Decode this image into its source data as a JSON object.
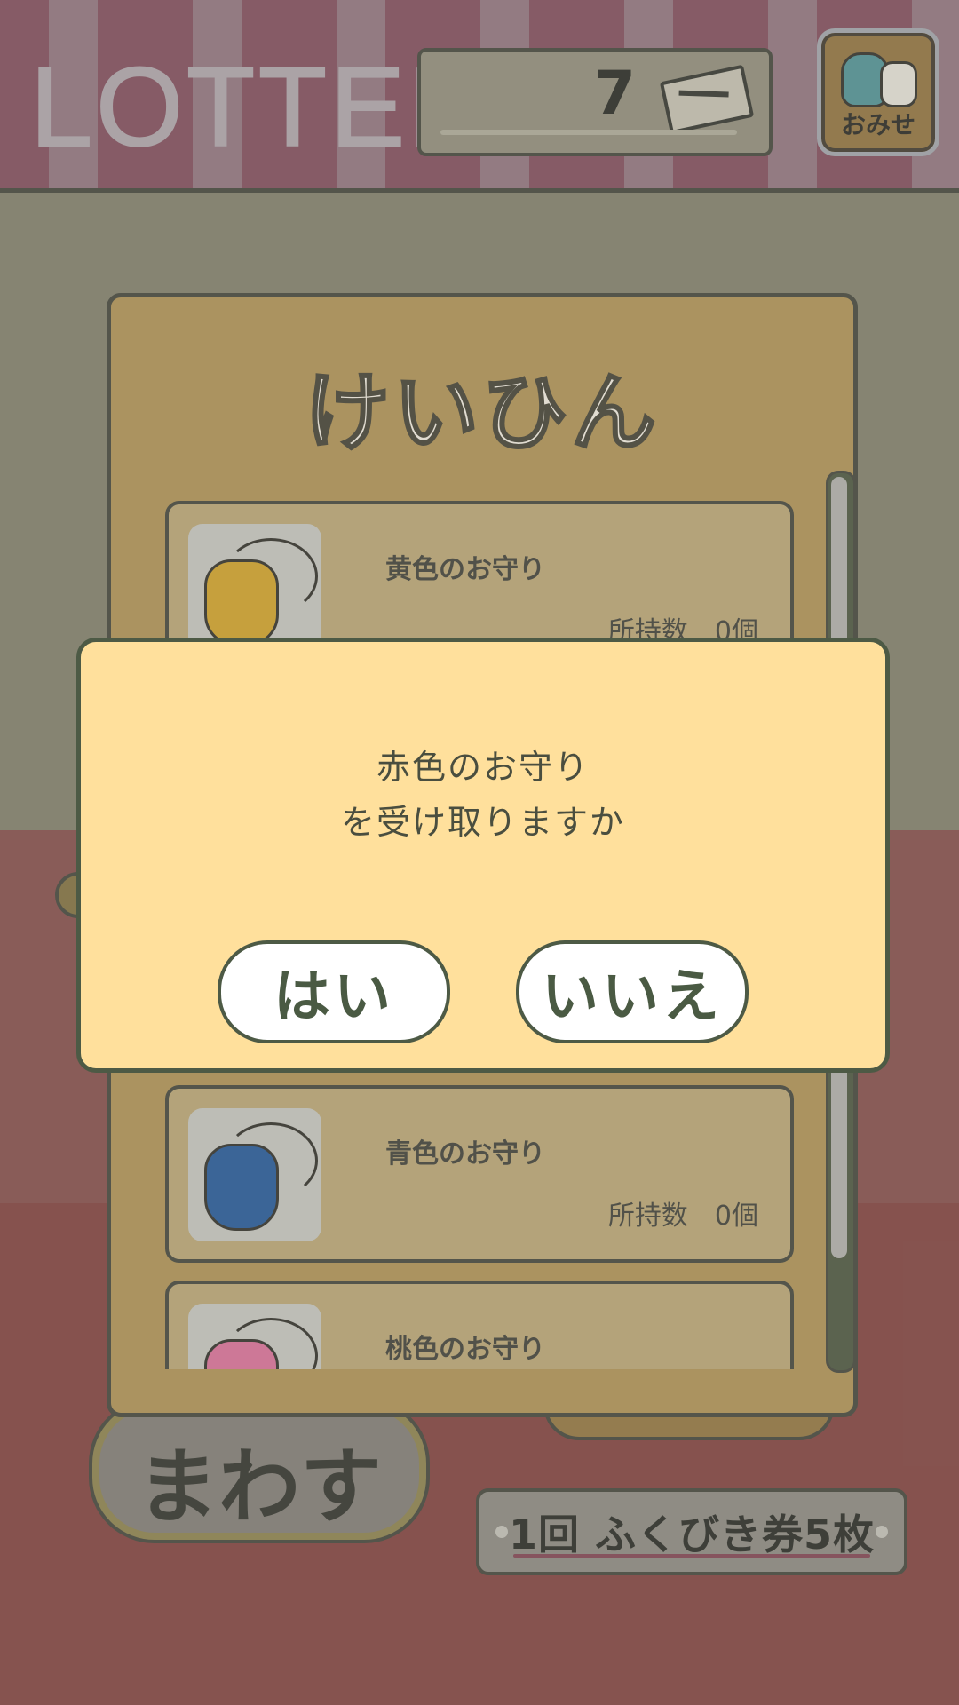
{
  "header": {
    "title": "LOTTERY",
    "ticket_count": "7",
    "shop_label": "おみせ"
  },
  "prize_panel": {
    "title": "けいひん",
    "items": [
      {
        "name": "黄色のお守り",
        "owned": "所持数　0個",
        "color": "#c99a22",
        "icon": "yellow-charm-pouch"
      },
      {
        "name": "青色のお守り",
        "owned": "所持数　0個",
        "color": "#1f528f",
        "icon": "blue-charm-pouch"
      },
      {
        "name": "桃色のお守り",
        "owned": "",
        "color": "#d16a8f",
        "icon": "pink-charm-pouch"
      }
    ]
  },
  "controls": {
    "spin_label": "まわす",
    "cost_label": "1回 ふくびき券5枚"
  },
  "dialog": {
    "line1": "赤色のお守り",
    "line2": "を受け取りますか",
    "yes_label": "はい",
    "no_label": "いいえ"
  },
  "colors": {
    "dialog_bg": "#ffe09c",
    "panel_bg": "#a88a4c",
    "card_bg": "#b29e6c",
    "outline": "#3d3f33"
  }
}
